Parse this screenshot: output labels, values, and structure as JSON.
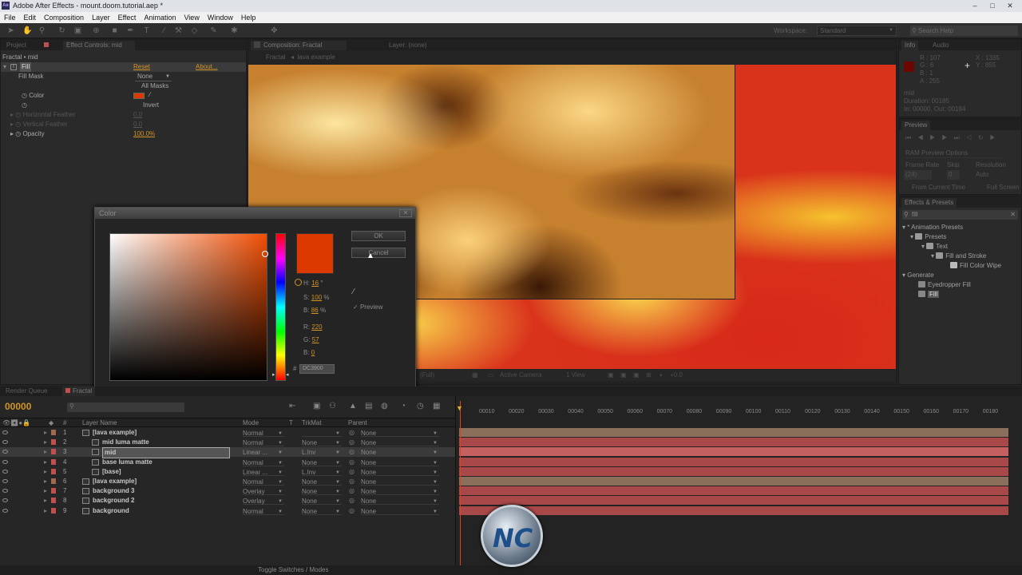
{
  "titlebar": {
    "title": "Adobe After Effects - mount.doom.tutorial.aep *"
  },
  "menu": [
    "File",
    "Edit",
    "Composition",
    "Layer",
    "Effect",
    "Animation",
    "View",
    "Window",
    "Help"
  ],
  "toolbar": {
    "workspace_label": "Workspace:",
    "workspace_value": "Standard",
    "search_placeholder": "Search Help"
  },
  "left_panel": {
    "tab_project": "Project",
    "tab_effect_controls": "Effect Controls: mid",
    "header": "Fractal • mid",
    "effect_name": "Fill",
    "reset": "Reset",
    "about": "About...",
    "rows": [
      {
        "label": "Fill Mask",
        "value": "None"
      },
      {
        "label": "",
        "value": "All Masks"
      },
      {
        "label": "Color",
        "value": ""
      },
      {
        "label": "",
        "value": "Invert"
      },
      {
        "label": "Horizontal Feather",
        "value": "0.0"
      },
      {
        "label": "Vertical Feather",
        "value": "0.0"
      },
      {
        "label": "Opacity",
        "value": "100.0%"
      }
    ]
  },
  "comp_panel": {
    "tab": "Composition: Fractal",
    "layer_tab": "Layer: (none)",
    "breadcrumb_1": "Fractal",
    "breadcrumb_2": "lava example",
    "footer_res": "(Full)",
    "footer_cam": "Active Camera",
    "footer_view": "1 View",
    "footer_exposure": "+0.0"
  },
  "color_dialog": {
    "title": "Color",
    "ok": "OK",
    "cancel": "Cancel",
    "preview": "Preview",
    "swatch_color": "#DC3900",
    "h_label": "H:",
    "h_value": "16",
    "h_unit": "°",
    "s_label": "S:",
    "s_value": "100",
    "s_unit": "%",
    "b_label": "B:",
    "b_value": "86",
    "b_unit": "%",
    "r_label": "R:",
    "r_value": "220",
    "g_label": "G:",
    "g_value": "57",
    "bl_label": "B:",
    "bl_value": "0",
    "hex_label": "#",
    "hex_value": "DC3900"
  },
  "info_panel": {
    "tab": "Info",
    "tab2": "Audio",
    "r": "R : 107",
    "g": "G : 6",
    "b": "B : 1",
    "a": "A : 255",
    "x": "X : 1335",
    "y": "Y : 855",
    "layer": "mid",
    "duration": "Duration: 00185",
    "in_out": "In: 00000, Out: 00184"
  },
  "preview_panel": {
    "tab": "Preview",
    "ram": "RAM Preview Options",
    "frame_rate": "Frame Rate",
    "skip": "Skip",
    "resolution": "Resolution",
    "fr_value": "(24)",
    "skip_value": "0",
    "res_value": "Auto",
    "from_current": "From Current Time",
    "full_screen": "Full Screen"
  },
  "effects_panel": {
    "tab": "Effects & Presets",
    "search_value": "fill",
    "tree": [
      {
        "label": "* Animation Presets",
        "indent": 0
      },
      {
        "label": "Presets",
        "indent": 1
      },
      {
        "label": "Text",
        "indent": 2
      },
      {
        "label": "Fill and Stroke",
        "indent": 3
      },
      {
        "label": "Fill Color Wipe",
        "indent": 4
      },
      {
        "label": "Generate",
        "indent": 0
      },
      {
        "label": "Eyedropper Fill",
        "indent": 1
      },
      {
        "label": "Fill",
        "indent": 1
      }
    ]
  },
  "timeline": {
    "tab1": "Render Queue",
    "tab2": "Fractal",
    "timecode": "00000",
    "col_layer": "Layer Name",
    "col_mode": "Mode",
    "col_t": "T",
    "col_trkmat": "TrkMat",
    "col_parent": "Parent",
    "ticks": [
      "00010",
      "00020",
      "00030",
      "00040",
      "00050",
      "00060",
      "00070",
      "00080",
      "00090",
      "00100",
      "00110",
      "00120",
      "00130",
      "00140",
      "00150",
      "00160",
      "00170",
      "00180"
    ],
    "layers": [
      {
        "num": "1",
        "name": "[lava example]",
        "mode": "Normal",
        "trkmat": "",
        "parent": "None",
        "label": "#a06a50",
        "indent": 0
      },
      {
        "num": "2",
        "name": "mid luma matte",
        "mode": "Normal",
        "trkmat": "None",
        "parent": "None",
        "label": "#c0504d",
        "indent": 1
      },
      {
        "num": "3",
        "name": "mid",
        "mode": "Linear ...",
        "trkmat": "L.Inv",
        "parent": "None",
        "label": "#c0504d",
        "indent": 1
      },
      {
        "num": "4",
        "name": "base luma matte",
        "mode": "Normal",
        "trkmat": "None",
        "parent": "None",
        "label": "#c0504d",
        "indent": 1
      },
      {
        "num": "5",
        "name": "[base]",
        "mode": "Linear ...",
        "trkmat": "L.Inv",
        "parent": "None",
        "label": "#c0504d",
        "indent": 1
      },
      {
        "num": "6",
        "name": "[lava example]",
        "mode": "Normal",
        "trkmat": "None",
        "parent": "None",
        "label": "#a06a50",
        "indent": 0
      },
      {
        "num": "7",
        "name": "background 3",
        "mode": "Overlay",
        "trkmat": "None",
        "parent": "None",
        "label": "#c0504d",
        "indent": 0
      },
      {
        "num": "8",
        "name": "background 2",
        "mode": "Overlay",
        "trkmat": "None",
        "parent": "None",
        "label": "#c0504d",
        "indent": 0
      },
      {
        "num": "9",
        "name": "background",
        "mode": "Normal",
        "trkmat": "None",
        "parent": "None",
        "label": "#c0504d",
        "indent": 0
      }
    ],
    "toggle": "Toggle Switches / Modes"
  },
  "watermark": {
    "text": "NC"
  }
}
